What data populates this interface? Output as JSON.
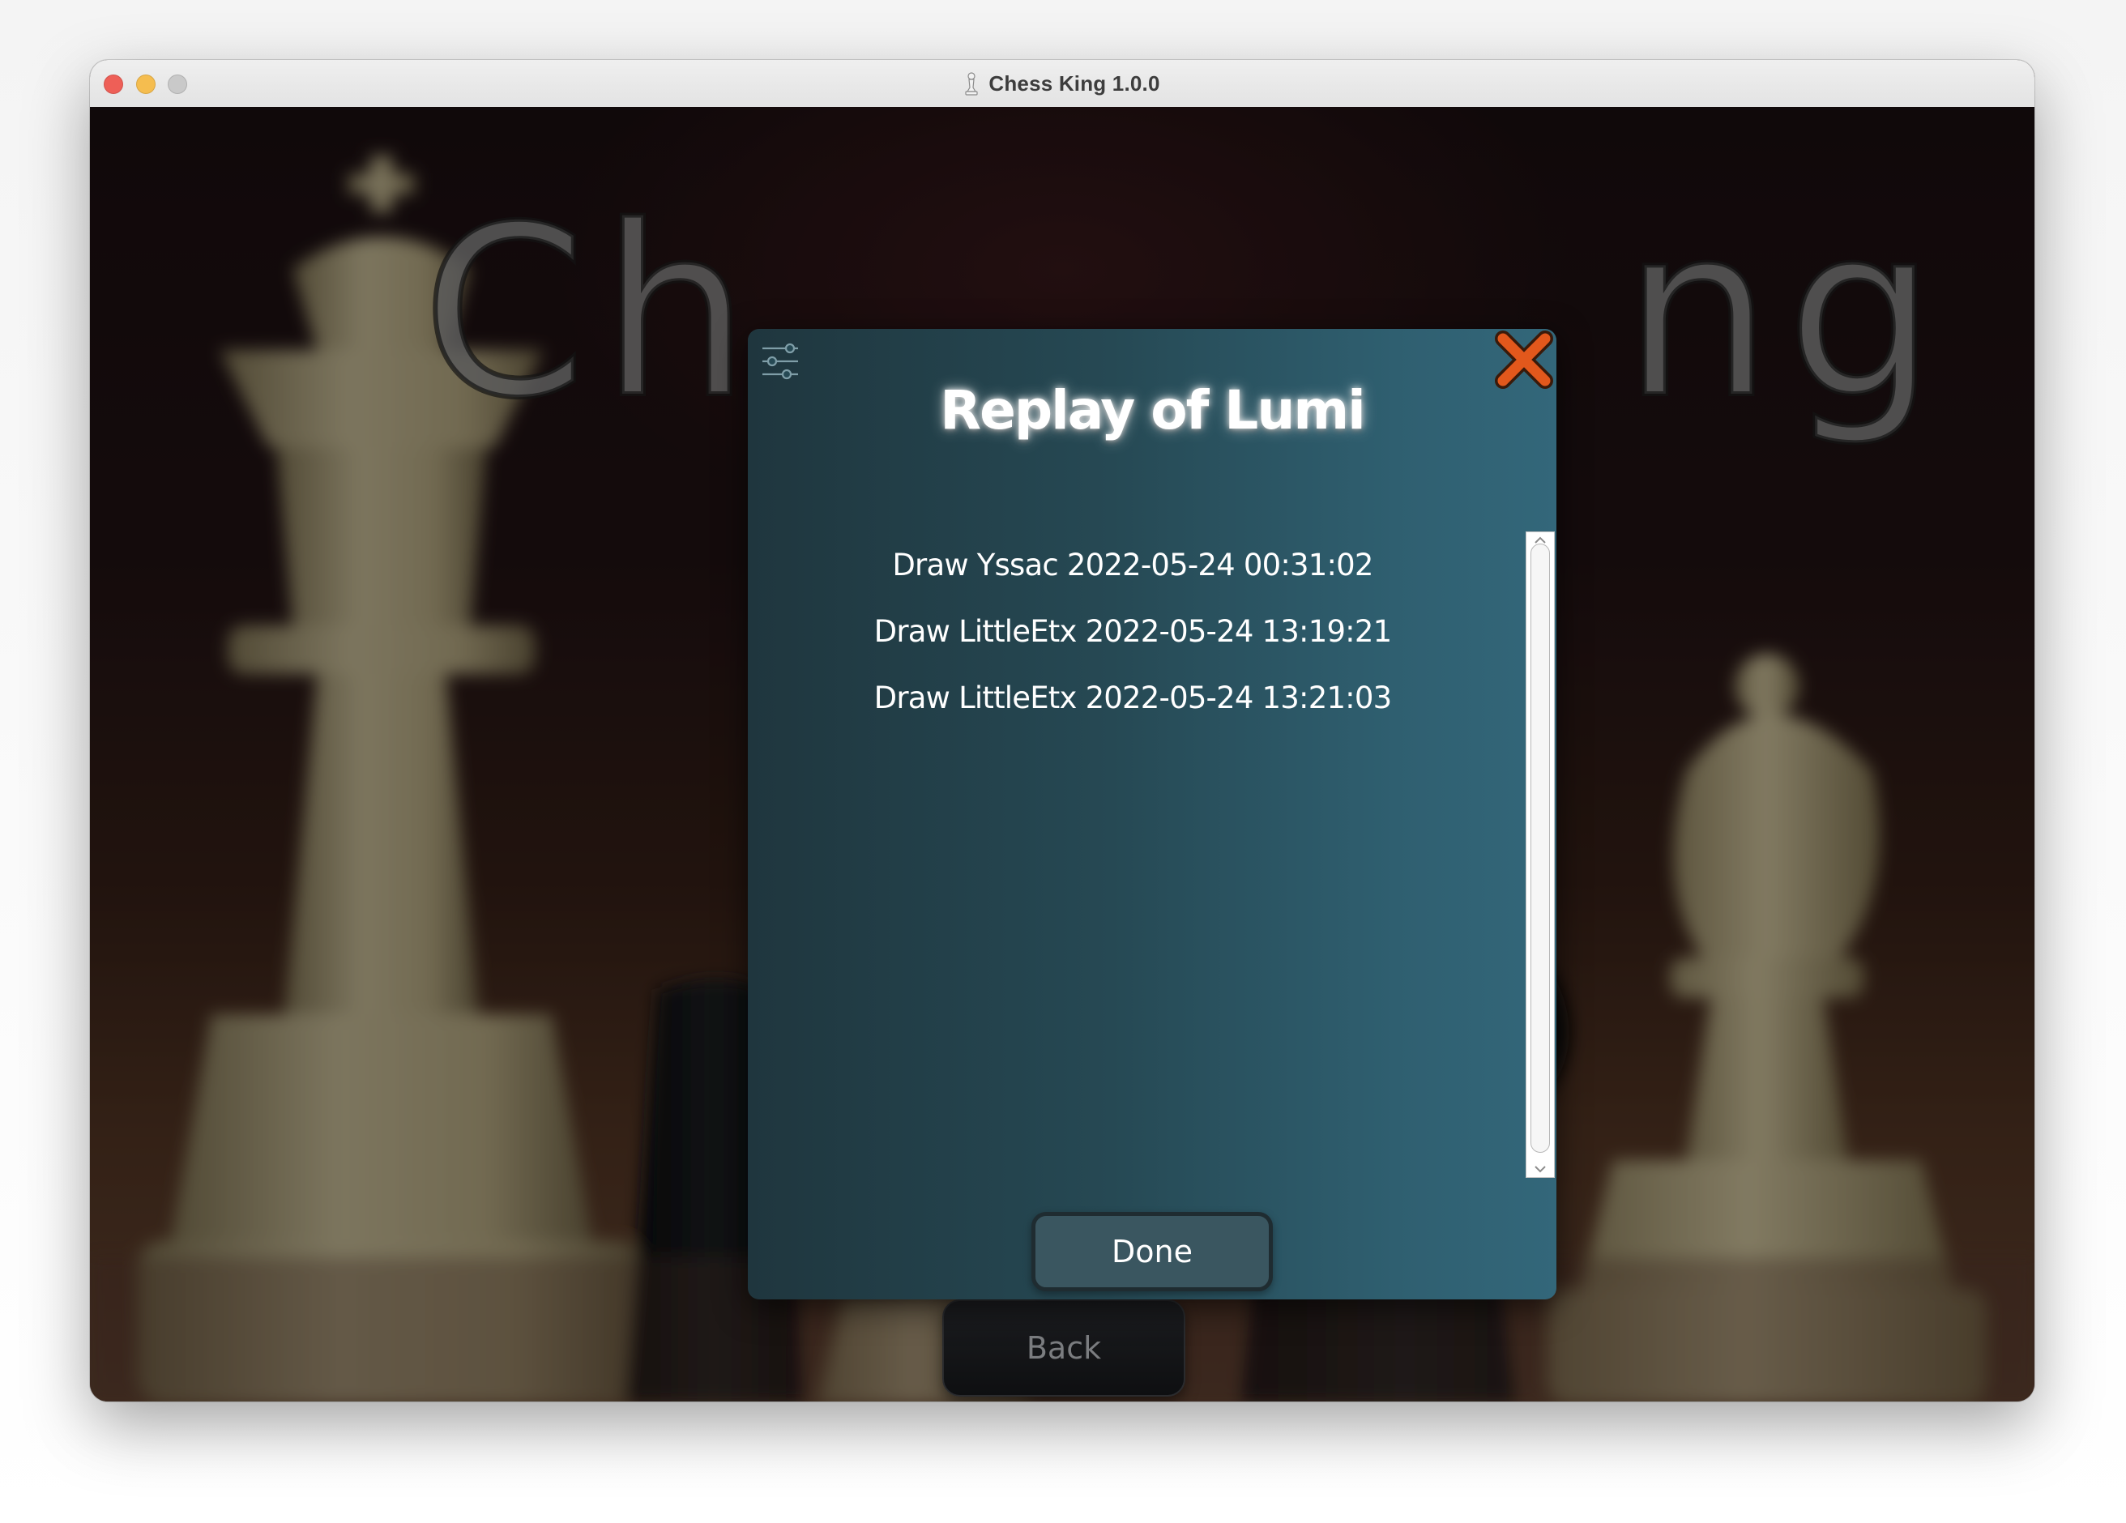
{
  "window": {
    "title": "Chess King 1.0.0",
    "app_icon": "chess-pawn-icon",
    "controls": {
      "close": "window-close-button",
      "minimize": "window-minimize-button",
      "maximize": "window-maximize-button"
    }
  },
  "background": {
    "title_visible_left": "Ch",
    "title_visible_right": "ng",
    "back_label": "Back"
  },
  "dialog": {
    "title": "Replay of Lumi",
    "settings_icon": "sliders-icon",
    "close_icon": "close-x-icon",
    "items": [
      {
        "label": "Draw Yssac 2022-05-24 00:31:02"
      },
      {
        "label": "Draw LittleEtx 2022-05-24 13:19:21"
      },
      {
        "label": "Draw LittleEtx 2022-05-24 13:21:03"
      }
    ],
    "done_label": "Done"
  },
  "colors": {
    "dialog_left": "#1f363e",
    "dialog_right": "#33677a",
    "close_x": "#e2581c",
    "traffic_close": "#ee5f57",
    "traffic_min": "#f5bd4f",
    "traffic_max": "#c9c9c9"
  }
}
